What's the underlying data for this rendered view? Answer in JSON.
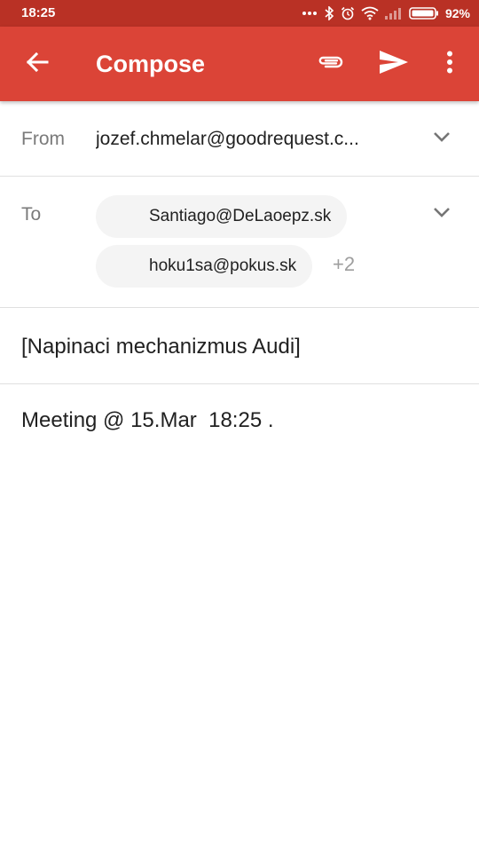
{
  "status_bar": {
    "time": "18:25",
    "battery_percent": "92%",
    "icons": [
      "more-dots-icon",
      "bluetooth-icon",
      "alarm-icon",
      "wifi-icon",
      "signal-icon",
      "battery-icon"
    ]
  },
  "app_bar": {
    "title": "Compose",
    "color": "#db4437",
    "status_color": "#b93125",
    "icons": [
      "back-arrow-icon",
      "attach-icon",
      "send-icon",
      "more-vert-icon"
    ]
  },
  "from": {
    "label": "From",
    "value": "jozef.chmelar@goodrequest.c..."
  },
  "to": {
    "label": "To",
    "recipients": [
      "Santiago@DeLaoepz.sk",
      "hoku1sa@pokus.sk"
    ],
    "more_count": "+2"
  },
  "subject": {
    "value": "[Napinaci mechanizmus Audi]"
  },
  "body": {
    "value": "Meeting @ 15.Mar  18:25 ."
  }
}
